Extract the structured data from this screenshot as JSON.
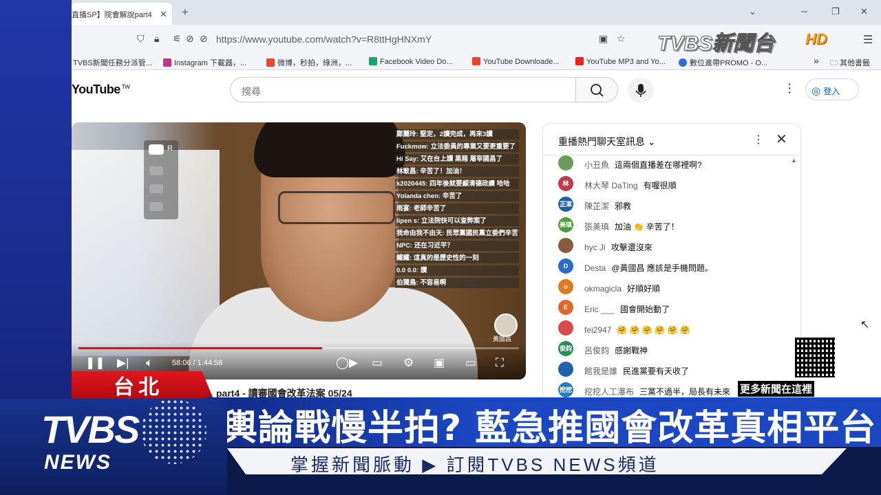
{
  "browser": {
    "tab_title": "直播SP】院會解說part4",
    "tab_close": "✕",
    "new_tab": "+",
    "url": "https://www.youtube.com/watch?v=R8ttHgHNXmY",
    "bookmarks": [
      {
        "label": "TVBS新聞任務分派管...",
        "color": "#ffffff"
      },
      {
        "label": "Instagram 下載器，...",
        "color": "#c13584"
      },
      {
        "label": "微博，秒拍，綠洲，...",
        "color": "#e8452c"
      },
      {
        "label": "Facebook Video Do...",
        "color": "#1aa36b"
      },
      {
        "label": "YouTube Downloade...",
        "color": "#e8452c"
      },
      {
        "label": "YouTube MP3 and Yo...",
        "color": "#e8261b"
      },
      {
        "label": "數位進帶PROMO - O...",
        "color": "#2b6fd6"
      }
    ],
    "bookmarks_more": "»",
    "other_bookmarks": "其他書籤"
  },
  "youtube": {
    "logo": "YouTube",
    "logo_sup": "TW",
    "search_placeholder": "搜尋",
    "signin_label": "登入"
  },
  "video": {
    "time": "58:06 / 1:44:58",
    "progress": 0.553,
    "under_title": "part4 - 讀審國會改革法案 05/24",
    "watermark_name": "黃國昌",
    "overlay_lines": [
      "鄭麗玲: 堅定，2讀完成，再來3讀",
      "Fuckmow: 立法委員的專業又要更重要了",
      "Hi Say: 又在台上讀 黑箱 屠宰國昌了",
      "林敢昌: 辛苦了！加油！",
      "k2020445: 四年後就要顧清德政績 哈哈",
      "Yolanda chen: 辛苦了",
      "雨宴: 老師辛苦了",
      "lipen s: 立法院快可以查弊案了",
      "我命由我不由天: 民眾黨國民黨立委們辛苦了！謝謝您們！",
      "NPC: 还在习近平？",
      "鐵鐵: 這真的是歷史性的一刻",
      "0.0 0.0: 讚",
      "伯獨鳥: 不容易啊"
    ]
  },
  "chat": {
    "title": "重播熱門聊天室訊息",
    "messages": [
      {
        "author": "小丑魚",
        "text": "這兩個直播差在哪裡啊?",
        "avatar": "",
        "color": "#6a9c5a"
      },
      {
        "author": "林大琴 DaTing",
        "text": "有喔很順",
        "avatar": "林",
        "color": "#c0394a"
      },
      {
        "author": "陳芷潔",
        "text": "邪教",
        "avatar": "芷潔",
        "color": "#1f5fa8"
      },
      {
        "author": "張美瑱",
        "text": "加油 👏 辛苦了！",
        "avatar": "美瑱",
        "color": "#4f9a3a"
      },
      {
        "author": "hyc Ji",
        "text": "攻擊還沒來",
        "avatar": "",
        "color": "#8b5a3c"
      },
      {
        "author": "Desta",
        "text": "@黃國昌 應該是手機問題。",
        "avatar": "D",
        "color": "#2a6cc7"
      },
      {
        "author": "okmagicla",
        "text": "好順好順",
        "avatar": "o",
        "color": "#e07a1e"
      },
      {
        "author": "Eric ___",
        "text": "國會開始動了",
        "avatar": "E",
        "color": "#e0672a"
      },
      {
        "author": "fei2947",
        "text": "🤗 🤗 🤗 🤗 🤗 🤗",
        "avatar": "",
        "color": "#d94a4a"
      },
      {
        "author": "呂俊鈞",
        "text": "感謝戰神",
        "avatar": "俊鈞",
        "color": "#2b8a5a"
      },
      {
        "author": "館我是誰",
        "text": "民進黨要有天收了",
        "avatar": "",
        "color": "#2062b0"
      },
      {
        "author": "挖挖人工瀑布",
        "text": "三黨不過半，局長有未來",
        "avatar": "挖挖",
        "color": "#2a7bbd"
      }
    ]
  },
  "news": {
    "location": "台北",
    "headline": "輿論戰慢半拍? 藍急推國會改革真相平台",
    "subline": "掌握新聞脈動 ▶ 訂閱TVBS NEWS頻道",
    "logo_main": "TVBS",
    "logo_sub": "NEWS",
    "corner_logo": "TVBS新聞台",
    "corner_hd": "HD",
    "qr_caption": "更多新聞在這裡"
  }
}
